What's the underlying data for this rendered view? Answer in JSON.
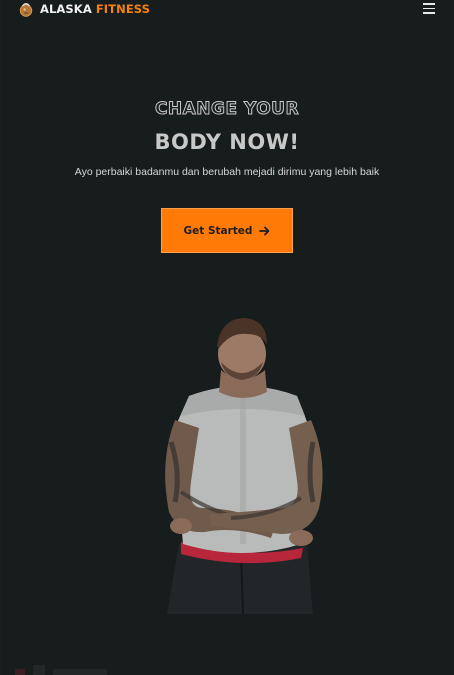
{
  "brand": {
    "name_primary": "ALASKA",
    "name_accent": "FITNESS",
    "logo_icon": "kettlebell-logo-icon",
    "accent_color": "#f5820e"
  },
  "nav": {
    "menu_icon": "hamburger-menu-icon"
  },
  "hero": {
    "eyebrow": "CHANGE YOUR",
    "headline": "BODY NOW!",
    "subtitle": "Ayo perbaiki badanmu dan berubah mejadi dirimu yang lebih baik",
    "cta_label": "Get Started",
    "cta_icon": "arrow-right-icon",
    "cta_color": "#ff7a07"
  },
  "colors": {
    "background": "#171c1c",
    "text": "#e5e5e5"
  }
}
